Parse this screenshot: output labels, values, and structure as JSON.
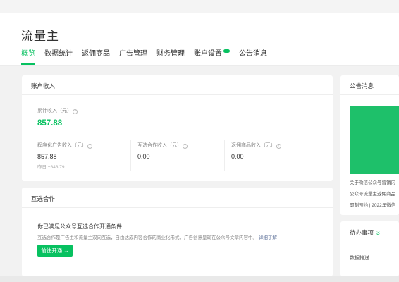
{
  "header": {
    "title": "流量主",
    "tabs": [
      {
        "label": "概览",
        "active": true
      },
      {
        "label": "数据统计"
      },
      {
        "label": "返佣商品"
      },
      {
        "label": "广告管理"
      },
      {
        "label": "财务管理"
      },
      {
        "label": "账户设置",
        "badge": true
      },
      {
        "label": "公告消息"
      }
    ]
  },
  "income": {
    "title": "账户收入",
    "total_label": "累计收入（元）",
    "total_value": "857.88",
    "items": [
      {
        "label": "程序化广告收入（元）",
        "value": "857.88",
        "note": "昨日 +843.79"
      },
      {
        "label": "互选合作收入（元）",
        "value": "0.00"
      },
      {
        "label": "返佣商品收入（元）",
        "value": "0.00"
      }
    ]
  },
  "mutual": {
    "title": "互选合作",
    "condition_title": "你已满足公众号互选合作开通条件",
    "condition_desc": "互选合作是广告主和流量主双向互选，自由达成内容合作的商业化形式，广告创意呈现在公众号文章内容中。",
    "detail_link": "详细了解",
    "button": "前往开通 →"
  },
  "notice": {
    "title": "公告消息",
    "items": [
      "关于微信公众号营销内",
      "公众号流量主返佣商品",
      "即刻预约 | 2022年微信"
    ]
  },
  "todo": {
    "title": "待办事项",
    "count": "3",
    "items": [
      "数据推送"
    ]
  },
  "colors": {
    "accent": "#07c160",
    "link": "#576b95"
  }
}
